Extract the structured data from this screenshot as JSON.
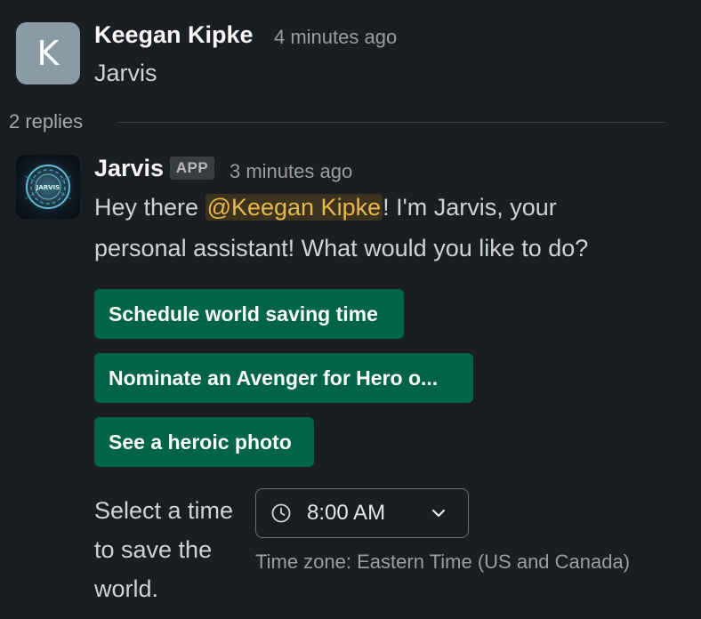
{
  "thread_parent": {
    "avatar_initial": "K",
    "author": "Keegan Kipke",
    "timestamp": "4 minutes ago",
    "text": "Jarvis"
  },
  "replies": {
    "count_label": "2 replies"
  },
  "reply": {
    "author": "Jarvis",
    "badge": "APP",
    "avatar_text": "JARVIS",
    "timestamp": "3 minutes ago",
    "text_prefix": "Hey there ",
    "mention": "@Keegan Kipke",
    "text_line1_suffix": "! I'm Jarvis, your",
    "text_line2": "personal assistant! What would you like to do?",
    "buttons": [
      {
        "label": "Schedule world saving time"
      },
      {
        "label": "Nominate an Avenger for Hero o..."
      },
      {
        "label": "See a heroic photo"
      }
    ],
    "time_picker": {
      "label": "Select a time to save the world.",
      "value": "8:00 AM",
      "timezone": "Time zone: Eastern Time (US and Canada)"
    }
  },
  "colors": {
    "background": "#1a1d21",
    "button_green": "#006447",
    "mention_yellow": "#e8b84a",
    "avatar_k_gray": "#8a9ba8"
  },
  "icons": {
    "clock": "clock-icon",
    "dropdown": "chevron-down-icon"
  }
}
